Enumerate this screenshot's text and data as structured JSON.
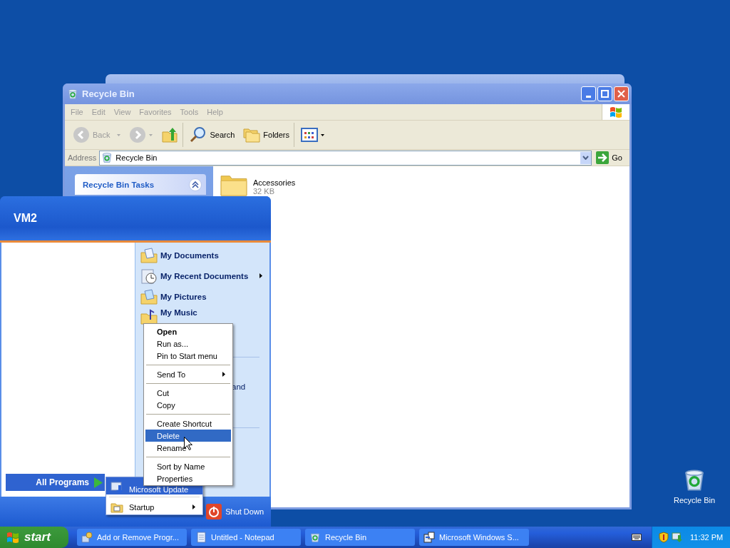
{
  "explorer": {
    "title": "Recycle Bin",
    "menu": [
      "File",
      "Edit",
      "View",
      "Favorites",
      "Tools",
      "Help"
    ],
    "toolbar": [
      {
        "kind": "back",
        "label": "Back"
      },
      {
        "kind": "forward"
      },
      {
        "kind": "up"
      },
      {
        "kind": "search",
        "label": "Search"
      },
      {
        "kind": "folders",
        "label": "Folders"
      },
      {
        "kind": "views"
      }
    ],
    "address": {
      "label": "Address",
      "value": "Recycle Bin",
      "go": "Go"
    },
    "tasks_panel": {
      "title": "Recycle Bin Tasks",
      "expanded": true
    },
    "items": [
      {
        "name": "Accessories",
        "size": "32 KB"
      }
    ]
  },
  "start_menu": {
    "user": "VM2",
    "places": [
      {
        "label": "My Documents",
        "kind": "documents",
        "submenu": false
      },
      {
        "label": "My Recent Documents",
        "kind": "recent",
        "submenu": true
      },
      {
        "label": "My Pictures",
        "kind": "pictures",
        "submenu": false
      },
      {
        "label": "My Music",
        "kind": "music",
        "submenu": false
      }
    ],
    "covered_text": "and",
    "all_programs": {
      "label": "All Programs",
      "selected": true
    },
    "shut_down": "Shut Down"
  },
  "programs_menu": [
    {
      "label": "Microsoft Update",
      "kind": "update",
      "selected": true,
      "submenu": false
    },
    {
      "label": "Startup",
      "kind": "folder",
      "selected": false,
      "submenu": true
    }
  ],
  "context_menu": [
    [
      {
        "label": "Open",
        "default": true,
        "selected": false,
        "submenu": false
      },
      {
        "label": "Run as...",
        "default": false,
        "selected": false,
        "submenu": false
      },
      {
        "label": "Pin to Start menu",
        "default": false,
        "selected": false,
        "submenu": false
      }
    ],
    [
      {
        "label": "Send To",
        "default": false,
        "selected": false,
        "submenu": true
      }
    ],
    [
      {
        "label": "Cut",
        "default": false,
        "selected": false,
        "submenu": false
      },
      {
        "label": "Copy",
        "default": false,
        "selected": false,
        "submenu": false
      }
    ],
    [
      {
        "label": "Create Shortcut",
        "default": false,
        "selected": false,
        "submenu": false
      },
      {
        "label": "Delete",
        "default": false,
        "selected": true,
        "submenu": false
      },
      {
        "label": "Rename",
        "default": false,
        "selected": false,
        "submenu": false
      }
    ],
    [
      {
        "label": "Sort by Name",
        "default": false,
        "selected": false,
        "submenu": false
      },
      {
        "label": "Properties",
        "default": false,
        "selected": false,
        "submenu": false
      }
    ]
  ],
  "desktop_icons": [
    {
      "label": "Recycle Bin"
    }
  ],
  "taskbar": {
    "start": "start",
    "tasks": [
      {
        "label": "Add or Remove Progr...",
        "kind": "programs",
        "selected": false
      },
      {
        "label": "Untitled - Notepad",
        "kind": "notepad",
        "selected": false
      },
      {
        "label": "Recycle Bin",
        "kind": "bin",
        "selected": false
      },
      {
        "label": "Microsoft Windows S...",
        "kind": "setup",
        "selected": false
      }
    ],
    "time": "11:32 PM"
  }
}
